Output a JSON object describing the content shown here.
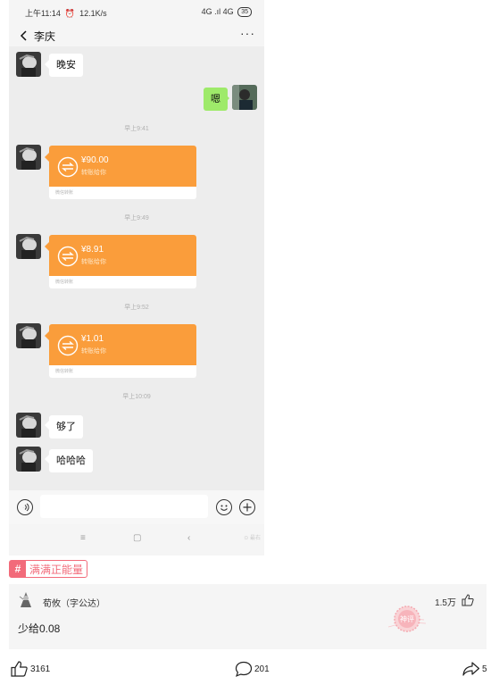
{
  "status_bar": {
    "time": "上午11:14",
    "speed": "12.1K/s",
    "network": "4G .ıl 4G",
    "battery": "35"
  },
  "chat": {
    "contact": "李庆",
    "messages": [
      {
        "kind": "text",
        "from": "them",
        "text": "晚安"
      },
      {
        "kind": "text",
        "from": "me",
        "text": "嗯"
      },
      {
        "kind": "time",
        "text": "早上9:41"
      },
      {
        "kind": "transfer",
        "from": "them",
        "amount": "¥90.00",
        "note": "转账给你",
        "footer": "微信转账"
      },
      {
        "kind": "time",
        "text": "早上9:49"
      },
      {
        "kind": "transfer",
        "from": "them",
        "amount": "¥8.91",
        "note": "转账给你",
        "footer": "微信转账"
      },
      {
        "kind": "time",
        "text": "早上9:52"
      },
      {
        "kind": "transfer",
        "from": "them",
        "amount": "¥1.01",
        "note": "转账给你",
        "footer": "微信转账"
      },
      {
        "kind": "time",
        "text": "早上10:09"
      },
      {
        "kind": "text",
        "from": "them",
        "text": "够了"
      },
      {
        "kind": "text",
        "from": "them",
        "text": "哈哈哈"
      }
    ]
  },
  "nav": {
    "menu": "≡",
    "home": "▢",
    "back": "‹"
  },
  "watermark": "⊙ 最右",
  "topic": {
    "label": "满满正能量"
  },
  "comment": {
    "user": "荀攸（字公达）",
    "text": "少给0.08",
    "likes": "1.5万",
    "stamp": "神评"
  },
  "actions": {
    "likes": "3161",
    "comments": "201",
    "shares": "5"
  },
  "colors": {
    "transfer": "#fa9d3b",
    "my_bubble": "#9eea6a",
    "topic": "#f26b7a",
    "chat_bg": "#ededed"
  }
}
